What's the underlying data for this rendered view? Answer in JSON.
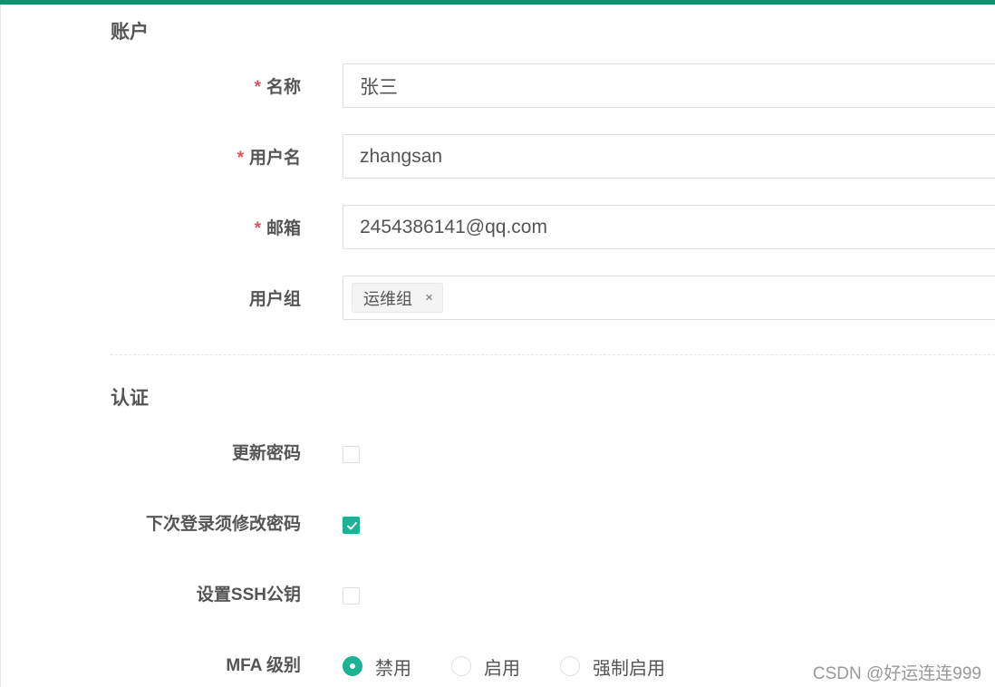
{
  "theme": {
    "accent": "#1ab394",
    "top_bar": "#1c8a6e",
    "required": "#e0505a"
  },
  "account_section": {
    "title": "账户",
    "fields": {
      "name": {
        "label": "名称",
        "required_mark": "*",
        "value": "张三"
      },
      "username": {
        "label": "用户名",
        "required_mark": "*",
        "value": "zhangsan"
      },
      "email": {
        "label": "邮箱",
        "required_mark": "*",
        "value": "2454386141@qq.com"
      },
      "user_group": {
        "label": "用户组",
        "tags": [
          "运维组"
        ],
        "tag_close": "×"
      }
    }
  },
  "auth_section": {
    "title": "认证",
    "update_password": {
      "label": "更新密码",
      "checked": false
    },
    "change_password_next_login": {
      "label": "下次登录须修改密码",
      "checked": true
    },
    "set_ssh_key": {
      "label": "设置SSH公钥",
      "checked": false
    },
    "mfa": {
      "label": "MFA 级别",
      "options": [
        "禁用",
        "启用",
        "强制启用"
      ],
      "selected": "禁用"
    }
  },
  "watermark": "CSDN @好运连连999"
}
